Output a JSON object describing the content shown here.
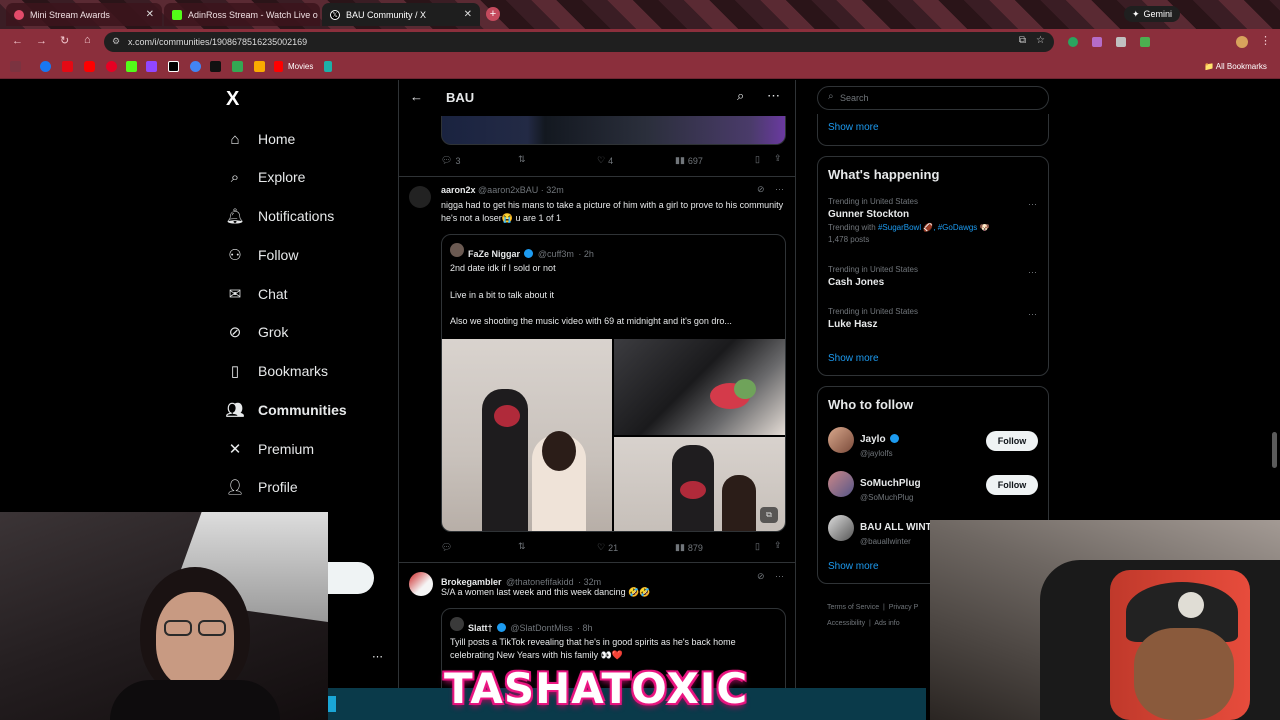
{
  "browser": {
    "tabs": [
      {
        "title": "Mini Stream Awards",
        "color": "#e34b6a"
      },
      {
        "title": "AdinRoss Stream - Watch Live o",
        "color": "#53fc18"
      },
      {
        "title": "BAU Community / X",
        "color": "#000000"
      }
    ],
    "gemini_label": "Gemini",
    "url": "x.com/i/communities/1908678516235002169",
    "bookmarks_movies": "Movies",
    "bookmarks_all": "All Bookmarks"
  },
  "nav": {
    "logo": "X",
    "items": [
      {
        "label": "Home",
        "icon": "home-icon"
      },
      {
        "label": "Explore",
        "icon": "search-icon"
      },
      {
        "label": "Notifications",
        "icon": "bell-icon"
      },
      {
        "label": "Follow",
        "icon": "person-add-icon"
      },
      {
        "label": "Chat",
        "icon": "mail-icon"
      },
      {
        "label": "Grok",
        "icon": "grok-icon"
      },
      {
        "label": "Bookmarks",
        "icon": "bookmark-icon"
      },
      {
        "label": "Communities",
        "icon": "communities-icon"
      },
      {
        "label": "Premium",
        "icon": "x-icon"
      },
      {
        "label": "Profile",
        "icon": "person-icon"
      }
    ]
  },
  "header": {
    "title": "BAU"
  },
  "posts": [
    {
      "actions": {
        "replies": "3",
        "reposts": "",
        "likes": "4",
        "views": "697"
      }
    },
    {
      "author": "aaron2x",
      "handle": "@aaron2xBAU",
      "time": "· 32m",
      "text": "nigga had to get his mans to take a picture of him with a girl to prove to his community he's not a loser😭 u are 1 of 1",
      "quote": {
        "author": "FaZe Niggar",
        "handle": "@cuff3m",
        "time": "· 2h",
        "line1": "2nd date idk if I sold or not",
        "line2": "Live in a bit to talk about it",
        "line3": "Also we shooting the music video with 69 at midnight and it's gon dro..."
      },
      "actions": {
        "replies": "",
        "reposts": "",
        "likes": "21",
        "views": "879"
      }
    },
    {
      "author": "Brokegambler",
      "handle": "@thatonefifakidd",
      "time": "· 32m",
      "text": "S/A a women last week and this week dancing 🤣🤣",
      "quote": {
        "author": "Slatt†",
        "handle": "@SlatDontMiss",
        "time": "· 8h",
        "line1": "Tyill posts a TikTok revealing that he's in good spirits as he's back home celebrating New Years with his family 👀❤️"
      }
    }
  ],
  "right": {
    "search_placeholder": "Search",
    "show_more": "Show more",
    "happening_title": "What's happening",
    "trends": [
      {
        "meta": "Trending in United States",
        "name": "Gunner Stockton",
        "with_label": "Trending with",
        "tags": "#SugarBowl 🏈, #GoDawgs 🐶",
        "posts": "1,478 posts"
      },
      {
        "meta": "Trending in United States",
        "name": "Cash Jones"
      },
      {
        "meta": "Trending in United States",
        "name": "Luke Hasz"
      }
    ],
    "who_title": "Who to follow",
    "follow_label": "Follow",
    "who": [
      {
        "name": "Jaylo",
        "handle": "@jaylolfs",
        "verified": true
      },
      {
        "name": "SoMuchPlug",
        "handle": "@SoMuchPlug",
        "verified": false
      },
      {
        "name": "BAU ALL WINTER",
        "handle": "@bauallwinter",
        "verified": false
      }
    ],
    "footer": {
      "terms": "Terms of Service",
      "privacy": "Privacy P",
      "accessibility": "Accessibility",
      "ads": "Ads info"
    }
  },
  "overlay": {
    "streamer_name": "TASHATOXIC"
  }
}
